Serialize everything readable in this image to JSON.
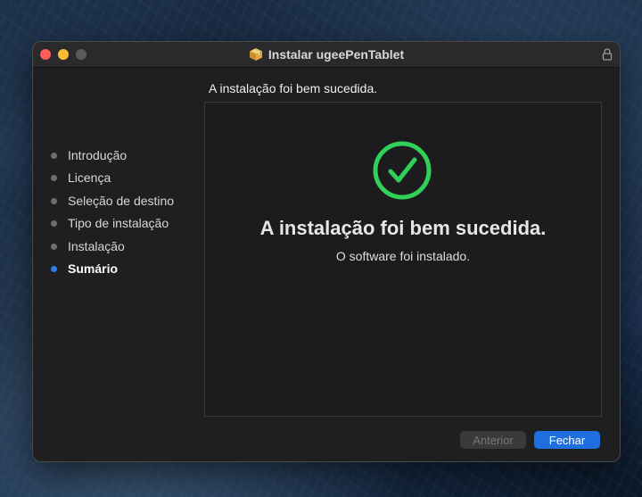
{
  "window": {
    "title": "Instalar ugeePenTablet",
    "title_icon": "package-icon"
  },
  "sidebar": {
    "steps": [
      {
        "label": "Introdução",
        "active": false
      },
      {
        "label": "Licença",
        "active": false
      },
      {
        "label": "Seleção de destino",
        "active": false
      },
      {
        "label": "Tipo de instalação",
        "active": false
      },
      {
        "label": "Instalação",
        "active": false
      },
      {
        "label": "Sumário",
        "active": true
      }
    ]
  },
  "main": {
    "heading": "A instalação foi bem sucedida.",
    "success_title": "A instalação foi bem sucedida.",
    "success_message": "O software foi instalado.",
    "status_icon": "checkmark-circle-icon"
  },
  "buttons": {
    "back_label": "Anterior",
    "back_enabled": false,
    "close_label": "Fechar"
  },
  "colors": {
    "accent": "#1f6fe0",
    "active_dot": "#2f7ef7",
    "success": "#30d158"
  }
}
